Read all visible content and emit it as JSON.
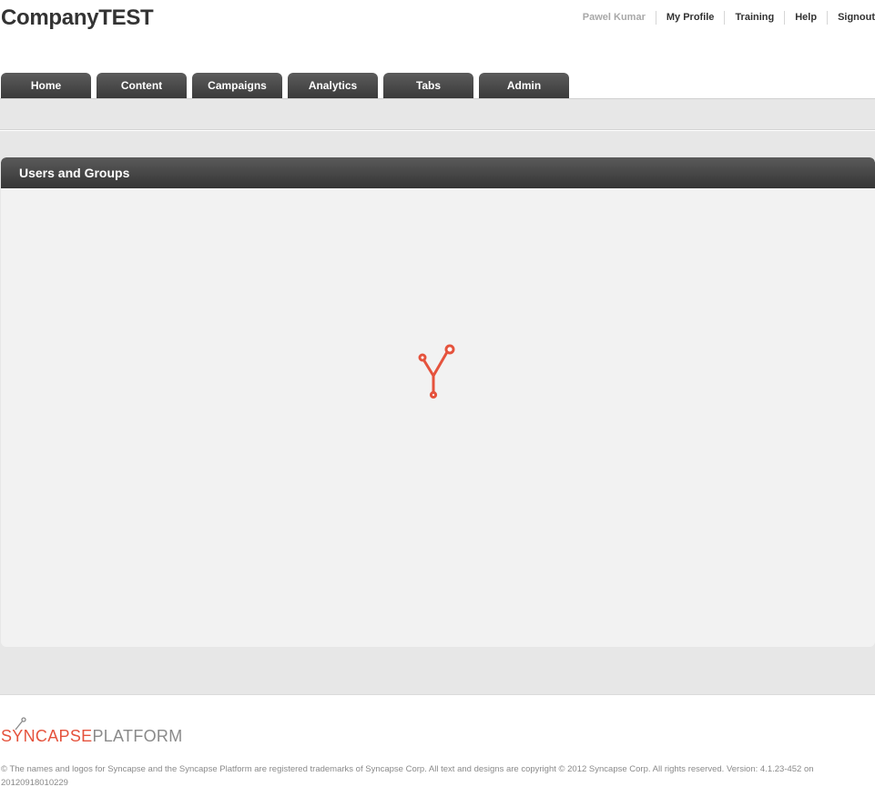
{
  "header": {
    "company_title": "CompanyTEST",
    "user_nav": [
      "Pawel Kumar",
      "My Profile",
      "Training",
      "Help",
      "Signout"
    ]
  },
  "tabs": [
    "Home",
    "Content",
    "Campaigns",
    "Analytics",
    "Tabs",
    "Admin"
  ],
  "panel": {
    "title": "Users and Groups",
    "loading_icon": "syncapse-y-spinner-icon"
  },
  "footer": {
    "logo_brand": "SYNCAPSE",
    "logo_platform": "PLATFORM",
    "legal": "© The names and logos for Syncapse and the Syncapse Platform are registered trademarks of Syncapse Corp. All text and designs are copyright © 2012 Syncapse Corp. All rights reserved. Version: 4.1.23-452 on 20120918010229"
  },
  "colors": {
    "accent": "#e5533d",
    "tab_bg": "#4a4a4a",
    "band_bg": "#e7e7e7",
    "panel_bg": "#f2f2f2"
  }
}
